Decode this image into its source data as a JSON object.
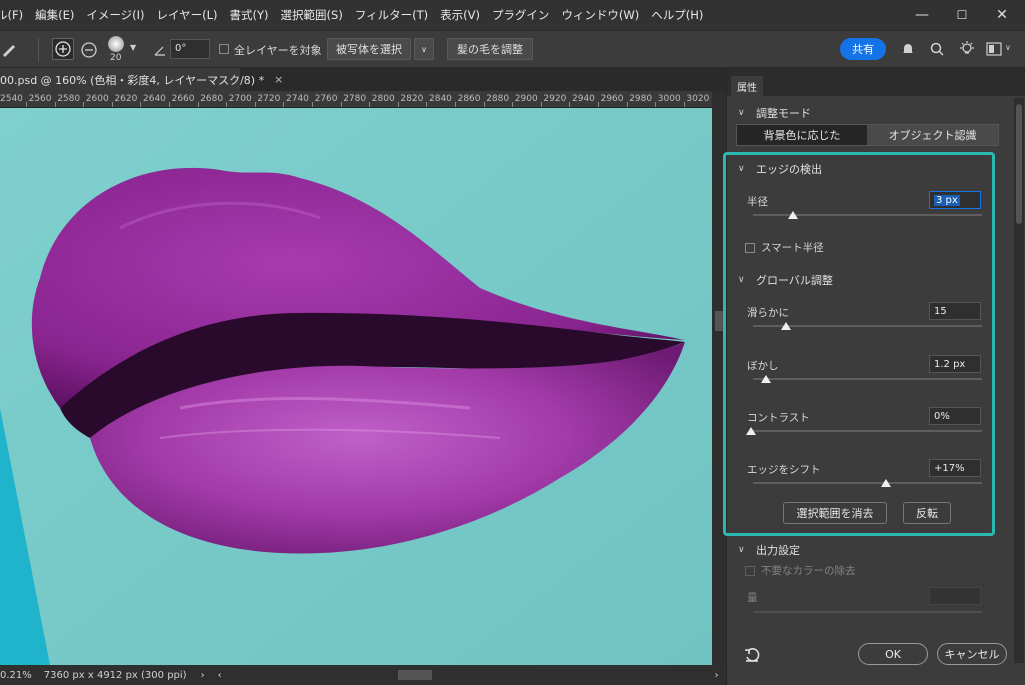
{
  "menubar": {
    "items": [
      "ル(F)",
      "編集(E)",
      "イメージ(I)",
      "レイヤー(L)",
      "書式(Y)",
      "選択範囲(S)",
      "フィルター(T)",
      "表示(V)",
      "プラグイン",
      "ウィンドウ(W)",
      "ヘルプ(H)"
    ],
    "minimize": "—",
    "maximize": "☐",
    "close": "✕"
  },
  "options": {
    "brush_size": "20",
    "angle": "0°",
    "sample_all_layers": "全レイヤーを対象",
    "select_subject": "被写体を選択",
    "refine_hair": "髪の毛を調整",
    "share": "共有"
  },
  "document": {
    "tab_title": "00.psd @ 160% (色相・彩度4, レイヤーマスク/8) *",
    "tab_close": "×",
    "ruler_ticks": [
      "2540",
      "2560",
      "2580",
      "2600",
      "2620",
      "2640",
      "2660",
      "2680",
      "2700",
      "2720",
      "2740",
      "2760",
      "2780",
      "2800",
      "2820",
      "2840",
      "2860",
      "2880",
      "2900",
      "2920",
      "2940",
      "2960",
      "2980",
      "3000",
      "3020"
    ],
    "zoom": "0.21%",
    "dimensions": "7360 px x 4912 px (300 ppi)",
    "nav_arrow": "›"
  },
  "panel": {
    "tab": "属性",
    "mode_heading": "調整モード",
    "mode_options": [
      "背景色に応じた",
      "オブジェクト認識"
    ],
    "edge_detection": {
      "heading": "エッジの検出",
      "radius_label": "半径",
      "radius_value": "3 px",
      "radius_level": 0.2,
      "smart_radius": "スマート半径"
    },
    "global": {
      "heading": "グローバル調整",
      "smooth_label": "滑らかに",
      "smooth_value": "15",
      "smooth_level": 0.15,
      "feather_label": "ぼかし",
      "feather_value": "1.2 px",
      "feather_level": 0.06,
      "contrast_label": "コントラスト",
      "contrast_value": "0%",
      "contrast_level": 0,
      "shift_label": "エッジをシフト",
      "shift_value": "+17%",
      "shift_level": 0.585,
      "clear_selection": "選択範囲を消去",
      "invert": "反転"
    },
    "output": {
      "heading": "出力設定",
      "decontaminate": "不要なカラーの除去",
      "amount_label": "量"
    },
    "ok": "OK",
    "cancel": "キャンセル"
  },
  "colors": {
    "accent_highlight": "#2ab8b0",
    "lip": "#9a2a9e",
    "skin": "#79cdcb",
    "share_blue": "#1473e6"
  }
}
